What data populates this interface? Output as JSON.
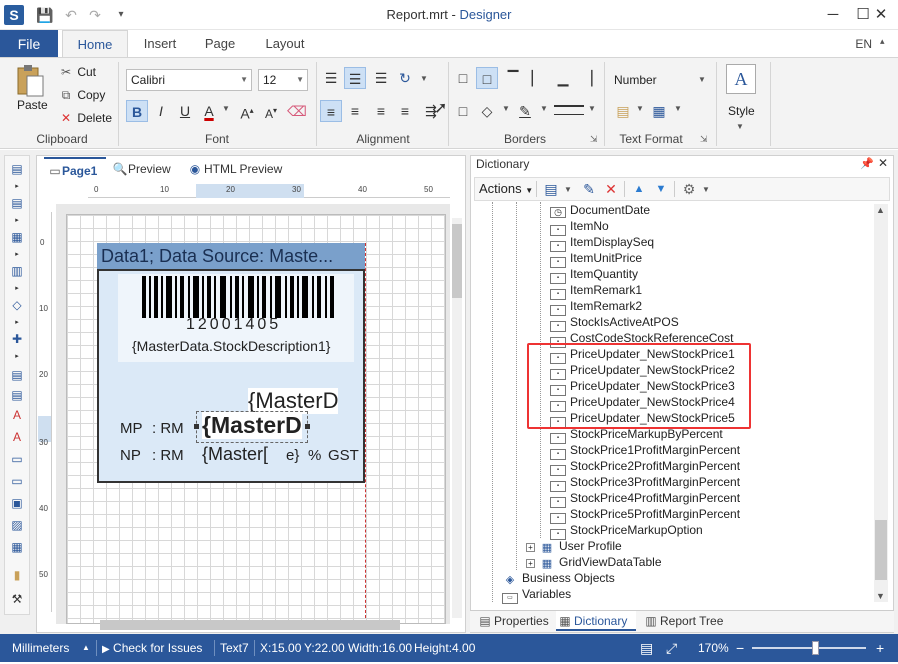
{
  "window": {
    "title_file": "Report.mrt",
    "title_sep": " - ",
    "title_app": "Designer",
    "minimize": "─",
    "maximize": "☐",
    "close": "✕"
  },
  "ribbon_tabs": {
    "file": "File",
    "tabs": [
      "Home",
      "Insert",
      "Page",
      "Layout"
    ],
    "language": "EN"
  },
  "clipboard": {
    "paste": "Paste",
    "cut": "Cut",
    "copy": "Copy",
    "delete": "Delete",
    "label": "Clipboard"
  },
  "font": {
    "family": "Calibri",
    "size": "12",
    "bold": "B",
    "italic": "I",
    "underline": "U",
    "color": "A",
    "grow": "A",
    "shrink": "A",
    "label": "Font"
  },
  "alignment": {
    "label": "Alignment"
  },
  "borders": {
    "label": "Borders"
  },
  "text_format": {
    "format": "Number",
    "label": "Text Format"
  },
  "style": {
    "label": "Style"
  },
  "designer_tabs": {
    "page": "Page1",
    "preview": "Preview",
    "html_preview": "HTML Preview"
  },
  "ruler_h": [
    "0",
    "10",
    "20",
    "30",
    "40",
    "50"
  ],
  "ruler_v": [
    "0",
    "10",
    "20",
    "30",
    "40",
    "50"
  ],
  "report": {
    "band_header": "Data1; Data Source: Maste...",
    "barcode_number": "12001405",
    "description": "{MasterData.StockDescription1}",
    "master_right": "{MasterD",
    "mp_label": "MP",
    "rm1": ": RM",
    "master_bold": "{MasterD",
    "np_label": "NP",
    "rm2": ": RM",
    "master_small": "{Master[",
    "gst_e": "e}",
    "gst_percent": "%",
    "gst": "GST"
  },
  "dictionary": {
    "title": "Dictionary",
    "actions": "Actions",
    "items": [
      {
        "type": "date",
        "name": "DocumentDate",
        "indent": 70
      },
      {
        "type": "123",
        "name": "ItemNo",
        "indent": 70
      },
      {
        "type": "123",
        "name": "ItemDisplaySeq",
        "indent": 70
      },
      {
        "type": ".0",
        "name": "ItemUnitPrice",
        "indent": 70
      },
      {
        "type": ".0",
        "name": "ItemQuantity",
        "indent": 70
      },
      {
        "type": "abc",
        "name": "ItemRemark1",
        "indent": 70
      },
      {
        "type": "abc",
        "name": "ItemRemark2",
        "indent": 70
      },
      {
        "type": "abc",
        "name": "StockIsActiveAtPOS",
        "indent": 70
      },
      {
        "type": "abc",
        "name": "CostCodeStockReferenceCost",
        "indent": 70
      },
      {
        "type": ".0",
        "name": "PriceUpdater_NewStockPrice1",
        "indent": 70
      },
      {
        "type": ".0",
        "name": "PriceUpdater_NewStockPrice2",
        "indent": 70
      },
      {
        "type": ".0",
        "name": "PriceUpdater_NewStockPrice3",
        "indent": 70
      },
      {
        "type": ".0",
        "name": "PriceUpdater_NewStockPrice4",
        "indent": 70
      },
      {
        "type": ".0",
        "name": "PriceUpdater_NewStockPrice5",
        "indent": 70
      },
      {
        "type": ".0",
        "name": "StockPriceMarkupByPercent",
        "indent": 70
      },
      {
        "type": ".0",
        "name": "StockPrice1ProfitMarginPercent",
        "indent": 70
      },
      {
        "type": ".0",
        "name": "StockPrice2ProfitMarginPercent",
        "indent": 70
      },
      {
        "type": ".0",
        "name": "StockPrice3ProfitMarginPercent",
        "indent": 70
      },
      {
        "type": ".0",
        "name": "StockPrice4ProfitMarginPercent",
        "indent": 70
      },
      {
        "type": ".0",
        "name": "StockPrice5ProfitMarginPercent",
        "indent": 70
      },
      {
        "type": "abc",
        "name": "StockPriceMarkupOption",
        "indent": 70
      },
      {
        "type": "table",
        "name": "User Profile",
        "indent": 46
      },
      {
        "type": "table",
        "name": "GridViewDataTable",
        "indent": 46
      },
      {
        "type": "bo",
        "name": "Business Objects",
        "indent": 22
      },
      {
        "type": "var",
        "name": "Variables",
        "indent": 22
      }
    ]
  },
  "bottom_tabs": {
    "properties": "Properties",
    "dictionary": "Dictionary",
    "report_tree": "Report Tree"
  },
  "status": {
    "units": "Millimeters",
    "check": "Check for Issues",
    "component": "Text7",
    "x": "X:15.00",
    "y": "Y:22.00",
    "width": "Width:16.00",
    "height": "Height:4.00",
    "zoom": "170%",
    "zoom_level": 0.55
  }
}
